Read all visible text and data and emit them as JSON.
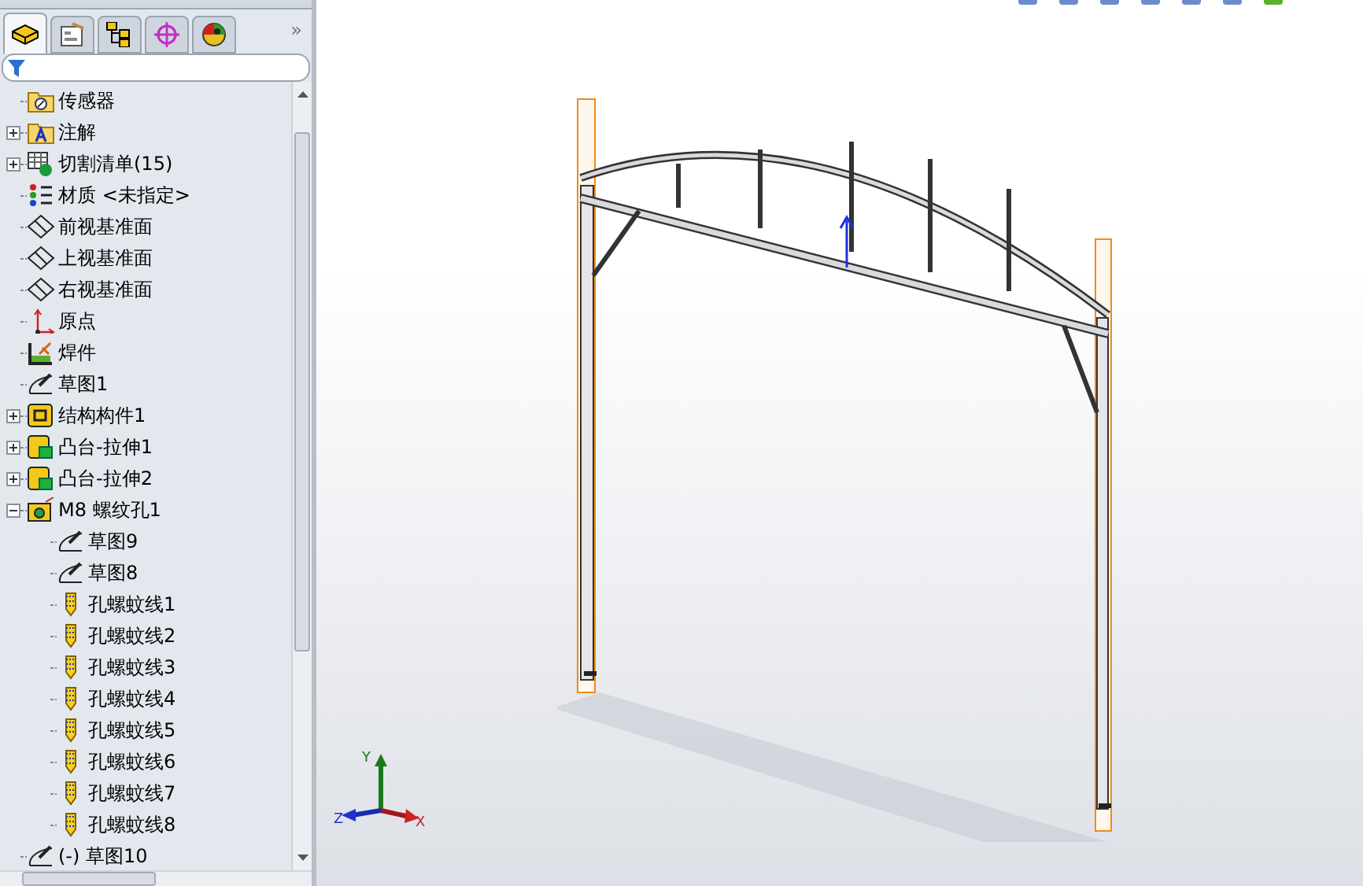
{
  "panel_tabs": [
    {
      "kind": "feature",
      "selected": true
    },
    {
      "kind": "property",
      "selected": false
    },
    {
      "kind": "config",
      "selected": false
    },
    {
      "kind": "dimxpert",
      "selected": false
    },
    {
      "kind": "display",
      "selected": false
    }
  ],
  "more_tabs": "»",
  "tree": [
    {
      "label": "传感器",
      "kind": "sensor"
    },
    {
      "label": "注解",
      "kind": "annotation",
      "expanded": false
    },
    {
      "label": "切割清单(15)",
      "kind": "cutlist",
      "expanded": false
    },
    {
      "label": "材质 <未指定>",
      "kind": "material"
    },
    {
      "label": "前视基准面",
      "kind": "plane"
    },
    {
      "label": "上视基准面",
      "kind": "plane"
    },
    {
      "label": "右视基准面",
      "kind": "plane"
    },
    {
      "label": "原点",
      "kind": "origin"
    },
    {
      "label": "焊件",
      "kind": "weldment"
    },
    {
      "label": "草图1",
      "kind": "sketch"
    },
    {
      "label": "结构构件1",
      "kind": "structural",
      "expanded": false
    },
    {
      "label": "凸台-拉伸1",
      "kind": "boss",
      "expanded": false
    },
    {
      "label": "凸台-拉伸2",
      "kind": "boss",
      "expanded": false
    },
    {
      "label": "M8 螺纹孔1",
      "kind": "hole",
      "expanded": true,
      "children": [
        {
          "label": "草图9",
          "kind": "sketch"
        },
        {
          "label": "草图8",
          "kind": "sketch"
        },
        {
          "label": "孔螺蚊线1",
          "kind": "thread"
        },
        {
          "label": "孔螺蚊线2",
          "kind": "thread"
        },
        {
          "label": "孔螺蚊线3",
          "kind": "thread"
        },
        {
          "label": "孔螺蚊线4",
          "kind": "thread"
        },
        {
          "label": "孔螺蚊线5",
          "kind": "thread"
        },
        {
          "label": "孔螺蚊线6",
          "kind": "thread"
        },
        {
          "label": "孔螺蚊线7",
          "kind": "thread"
        },
        {
          "label": "孔螺蚊线8",
          "kind": "thread"
        }
      ]
    },
    {
      "label": "(-) 草图10",
      "kind": "sketch"
    }
  ],
  "triad": {
    "y": "Y",
    "z": "Z",
    "x": "X"
  }
}
